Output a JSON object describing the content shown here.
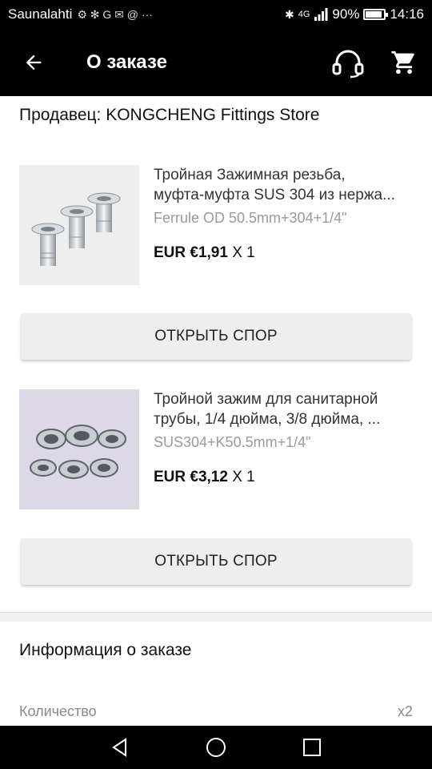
{
  "status_bar": {
    "carrier": "Saunalahti",
    "left_glyphs": "⚙ ✻ G ✉ @ ···",
    "signal": "4G",
    "battery_text": "90%",
    "battery_level": 0.9,
    "time": "14:16"
  },
  "app_bar": {
    "title": "О заказе",
    "back_icon": "arrow-left-icon",
    "support_icon": "headset-icon",
    "cart_icon": "cart-icon"
  },
  "seller": {
    "label": "Продавец: KONGCHENG Fittings Store"
  },
  "products": [
    {
      "title_line1": "Тройная Зажимная резьба,",
      "title_line2": "муфта-муфта SUS 304 из нержа...",
      "variant": "Ferrule OD 50.5mm+304+1/4\"",
      "price": "EUR €1,91",
      "quantity": "X 1",
      "dispute_label": "ОТКРЫТЬ СПОР"
    },
    {
      "title_line1": "Тройной зажим для санитарной",
      "title_line2": "трубы, 1/4 дюйма, 3/8 дюйма, ...",
      "variant": "SUS304+K50.5mm+1/4\"",
      "price": "EUR €3,12",
      "quantity": "X 1",
      "dispute_label": "ОТКРЫТЬ СПОР"
    }
  ],
  "order_info": {
    "title": "Информация о заказе",
    "quantity_label": "Количество",
    "quantity_value": "x2"
  },
  "colors": {
    "bar_background": "#000000",
    "button_background": "#eeeeee",
    "muted_text": "#9a9a9a"
  }
}
